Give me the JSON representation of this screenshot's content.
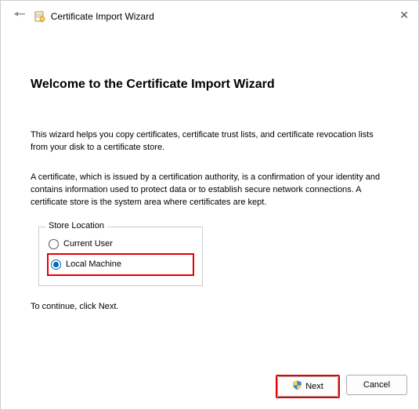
{
  "titlebar": {
    "wizard_name": "Certificate Import Wizard"
  },
  "heading": "Welcome to the Certificate Import Wizard",
  "paragraph1": "This wizard helps you copy certificates, certificate trust lists, and certificate revocation lists from your disk to a certificate store.",
  "paragraph2": "A certificate, which is issued by a certification authority, is a confirmation of your identity and contains information used to protect data or to establish secure network connections. A certificate store is the system area where certificates are kept.",
  "store_location": {
    "legend": "Store Location",
    "option1": "Current User",
    "option2": "Local Machine"
  },
  "continue_text": "To continue, click Next.",
  "buttons": {
    "next": "Next",
    "cancel": "Cancel"
  }
}
